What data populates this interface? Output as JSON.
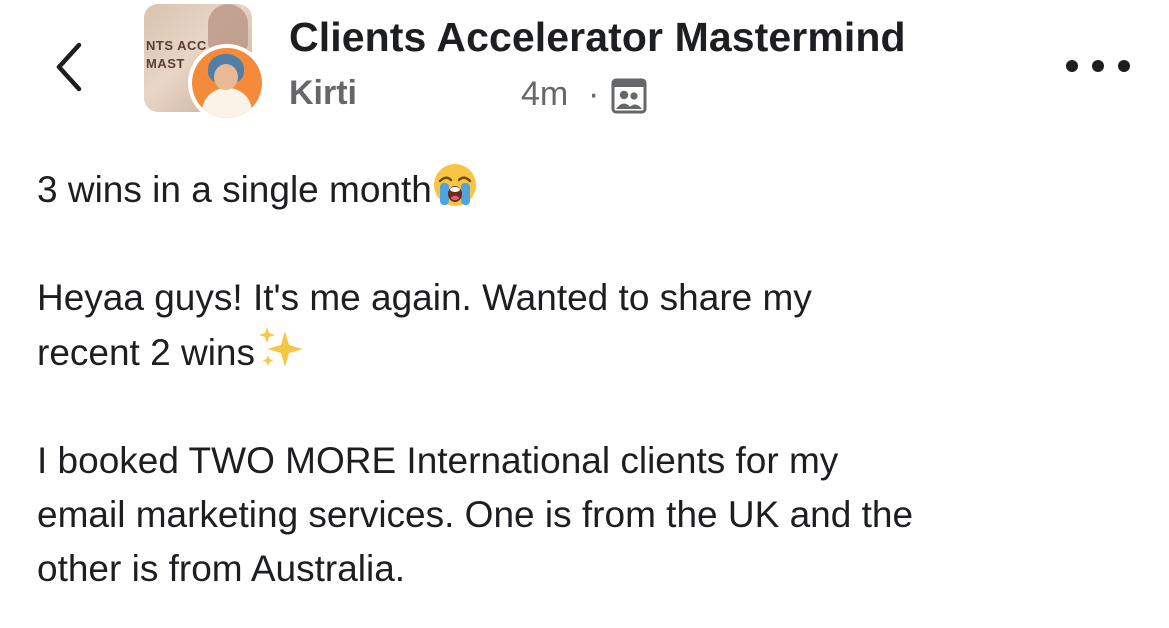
{
  "header": {
    "group_name": "Clients Accelerator Mastermind",
    "group_avatar_text": [
      "NTS ACC",
      "MAST"
    ],
    "author": "Kirti",
    "time": "4m",
    "separator": "·",
    "icons": {
      "back": "chevron-left-icon",
      "audience": "group-members-icon",
      "more": "more-horizontal-icon"
    }
  },
  "post": {
    "line1": "3 wins in a single month",
    "line1_emoji": "loudly-crying-face",
    "para2_line1": "Heyaa guys! It's me again. Wanted to share my",
    "para2_line2": "recent 2 wins",
    "para2_emoji": "sparkles",
    "para3_line1": "I booked TWO MORE International clients for my",
    "para3_line2": "email marketing services. One is from the UK and the",
    "para3_line3": "other is from Australia."
  },
  "colors": {
    "primary_text": "#1c1e21",
    "secondary_text": "#65676b",
    "background": "#ffffff",
    "avatar_ring": "#f48a3a"
  }
}
